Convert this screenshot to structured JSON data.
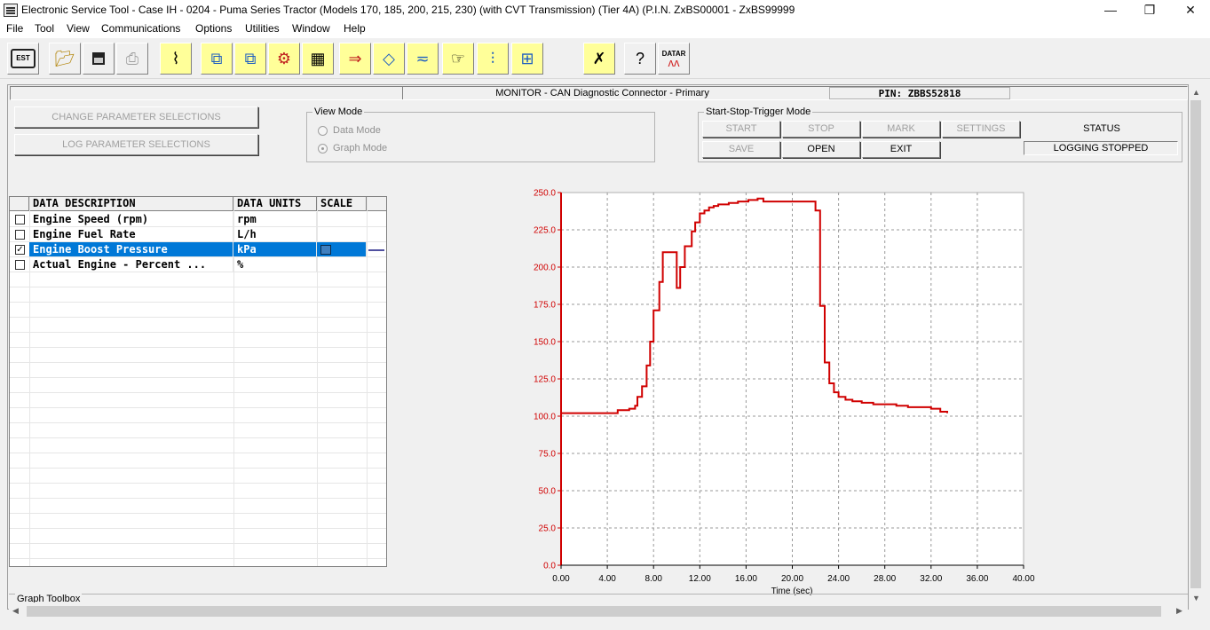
{
  "window": {
    "title": "Electronic Service Tool - Case IH - 0204 - Puma Series Tractor (Models 170, 185, 200, 215, 230) (with CVT Transmission) (Tier 4A) (P.I.N. ZxBS00001 - ZxBS99999",
    "minimize": "—",
    "restore": "❐",
    "close": "✕"
  },
  "menu": [
    "File",
    "Tool",
    "View",
    "Communications",
    "Options",
    "Utilities",
    "Window",
    "Help"
  ],
  "toolbar": {
    "est_label": "EST",
    "datar_label": "DATAR",
    "icons": [
      "est-icon",
      "open-folder-icon",
      "save-icon",
      "print-icon",
      "connector-icon",
      "network-icon",
      "network-alt-icon",
      "diagnostic-icon",
      "module-grid-icon",
      "flash-arrow-icon",
      "signal-diamond-icon",
      "cable-icon",
      "hand-icon",
      "bus-icon",
      "tree-icon",
      "tools-icon",
      "help-connector-icon",
      "datar-icon"
    ]
  },
  "monitor": {
    "label": "MONITOR  -  CAN Diagnostic Connector - Primary",
    "pin": "PIN: ZBBS52818"
  },
  "buttons": {
    "change_params": "CHANGE PARAMETER SELECTIONS",
    "log_params": "LOG PARAMETER SELECTIONS"
  },
  "view_mode": {
    "title": "View Mode",
    "data_mode": "Data Mode",
    "graph_mode": "Graph Mode",
    "selected": "Graph Mode"
  },
  "trigger": {
    "title": "Start-Stop-Trigger Mode",
    "start": "START",
    "stop": "STOP",
    "mark": "MARK",
    "settings": "SETTINGS",
    "save": "SAVE",
    "open": "OPEN",
    "exit": "EXIT",
    "status_label": "STATUS",
    "status_value": "LOGGING STOPPED"
  },
  "table": {
    "headers": [
      "DATA DESCRIPTION",
      "DATA UNITS",
      "SCALE"
    ],
    "rows": [
      {
        "description": "Engine Speed (rpm)",
        "units": "rpm",
        "checked": false,
        "selected": false
      },
      {
        "description": "Engine Fuel Rate",
        "units": "L/h",
        "checked": false,
        "selected": false
      },
      {
        "description": "Engine Boost Pressure",
        "units": "kPa",
        "checked": true,
        "selected": true
      },
      {
        "description": "Actual Engine - Percent ...",
        "units": "%",
        "checked": false,
        "selected": false
      }
    ]
  },
  "toolbox": {
    "label": "Graph Toolbox"
  },
  "chart_data": {
    "type": "line",
    "title": "",
    "xlabel": "Time (sec)",
    "ylabel": "",
    "xlim": [
      0,
      40
    ],
    "ylim": [
      0,
      250
    ],
    "x_ticks": [
      "0.00",
      "4.00",
      "8.00",
      "12.00",
      "16.00",
      "20.00",
      "24.00",
      "28.00",
      "32.00",
      "36.00",
      "40.00"
    ],
    "y_ticks": [
      "0.0",
      "25.0",
      "50.0",
      "75.0",
      "100.0",
      "125.0",
      "150.0",
      "175.0",
      "200.0",
      "225.0",
      "250.0"
    ],
    "grid": true,
    "line_color": "#d00000",
    "series": [
      {
        "name": "Engine Boost Pressure",
        "step": true,
        "x": [
          0,
          4.9,
          5.9,
          6.4,
          6.6,
          7.0,
          7.4,
          7.7,
          8.0,
          8.5,
          8.8,
          9.2,
          10.0,
          10.3,
          10.7,
          11.3,
          11.6,
          12.0,
          12.4,
          12.8,
          13.2,
          13.6,
          14.5,
          15.3,
          16.2,
          17.0,
          17.5,
          17.8,
          19.0,
          20.0,
          21.0,
          22.0,
          22.4,
          22.8,
          23.2,
          23.6,
          24.0,
          24.6,
          25.2,
          26.0,
          27.0,
          28.0,
          29.0,
          30.0,
          31.0,
          32.0,
          32.8,
          33.4
        ],
        "y": [
          102,
          104,
          105,
          107,
          113,
          120,
          134,
          150,
          171,
          190,
          210,
          210,
          186,
          200,
          214,
          224,
          230,
          236,
          238,
          240,
          241,
          242,
          243,
          244,
          245,
          246,
          244,
          244,
          244,
          244,
          244,
          238,
          174,
          136,
          122,
          116,
          113,
          111,
          110,
          109,
          108,
          108,
          107,
          106,
          106,
          105,
          103,
          102
        ]
      }
    ]
  }
}
